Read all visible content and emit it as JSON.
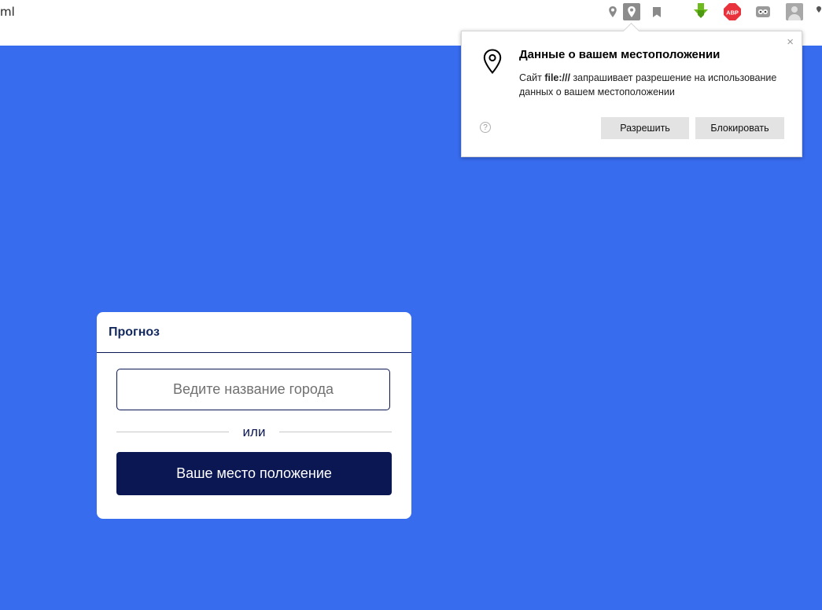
{
  "browser": {
    "url_fragment": "ml",
    "icons": [
      "location-pin-icon",
      "location-active-icon",
      "bookmark-icon",
      "download-icon",
      "adblock-icon",
      "extension-icon",
      "profile-icon",
      "more-icon"
    ],
    "adblock_label": "ABP"
  },
  "permission_popup": {
    "title": "Данные о вашем местоположении",
    "text_prefix": "Сайт ",
    "site": "file:///",
    "text_suffix": " запрашивает разрешение на использование данных о вашем местоположении",
    "help": "?",
    "close": "×",
    "allow_label": "Разрешить",
    "block_label": "Блокировать"
  },
  "card": {
    "title": "Прогноз",
    "city_placeholder": "Ведите название города",
    "or_label": "или",
    "location_button": "Ваше место положение"
  },
  "colors": {
    "page_background": "#386cee",
    "button_dark": "#0b1752"
  }
}
